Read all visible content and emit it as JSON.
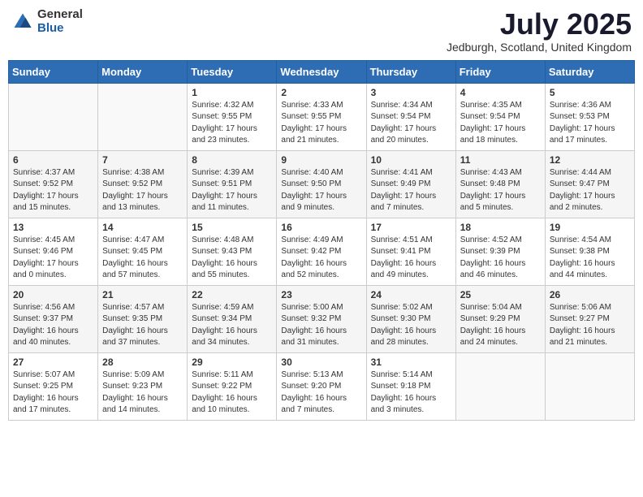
{
  "logo": {
    "general": "General",
    "blue": "Blue"
  },
  "title": "July 2025",
  "location": "Jedburgh, Scotland, United Kingdom",
  "weekdays": [
    "Sunday",
    "Monday",
    "Tuesday",
    "Wednesday",
    "Thursday",
    "Friday",
    "Saturday"
  ],
  "weeks": [
    [
      {
        "day": "",
        "sunrise": "",
        "sunset": "",
        "daylight": ""
      },
      {
        "day": "",
        "sunrise": "",
        "sunset": "",
        "daylight": ""
      },
      {
        "day": "1",
        "sunrise": "Sunrise: 4:32 AM",
        "sunset": "Sunset: 9:55 PM",
        "daylight": "Daylight: 17 hours and 23 minutes."
      },
      {
        "day": "2",
        "sunrise": "Sunrise: 4:33 AM",
        "sunset": "Sunset: 9:55 PM",
        "daylight": "Daylight: 17 hours and 21 minutes."
      },
      {
        "day": "3",
        "sunrise": "Sunrise: 4:34 AM",
        "sunset": "Sunset: 9:54 PM",
        "daylight": "Daylight: 17 hours and 20 minutes."
      },
      {
        "day": "4",
        "sunrise": "Sunrise: 4:35 AM",
        "sunset": "Sunset: 9:54 PM",
        "daylight": "Daylight: 17 hours and 18 minutes."
      },
      {
        "day": "5",
        "sunrise": "Sunrise: 4:36 AM",
        "sunset": "Sunset: 9:53 PM",
        "daylight": "Daylight: 17 hours and 17 minutes."
      }
    ],
    [
      {
        "day": "6",
        "sunrise": "Sunrise: 4:37 AM",
        "sunset": "Sunset: 9:52 PM",
        "daylight": "Daylight: 17 hours and 15 minutes."
      },
      {
        "day": "7",
        "sunrise": "Sunrise: 4:38 AM",
        "sunset": "Sunset: 9:52 PM",
        "daylight": "Daylight: 17 hours and 13 minutes."
      },
      {
        "day": "8",
        "sunrise": "Sunrise: 4:39 AM",
        "sunset": "Sunset: 9:51 PM",
        "daylight": "Daylight: 17 hours and 11 minutes."
      },
      {
        "day": "9",
        "sunrise": "Sunrise: 4:40 AM",
        "sunset": "Sunset: 9:50 PM",
        "daylight": "Daylight: 17 hours and 9 minutes."
      },
      {
        "day": "10",
        "sunrise": "Sunrise: 4:41 AM",
        "sunset": "Sunset: 9:49 PM",
        "daylight": "Daylight: 17 hours and 7 minutes."
      },
      {
        "day": "11",
        "sunrise": "Sunrise: 4:43 AM",
        "sunset": "Sunset: 9:48 PM",
        "daylight": "Daylight: 17 hours and 5 minutes."
      },
      {
        "day": "12",
        "sunrise": "Sunrise: 4:44 AM",
        "sunset": "Sunset: 9:47 PM",
        "daylight": "Daylight: 17 hours and 2 minutes."
      }
    ],
    [
      {
        "day": "13",
        "sunrise": "Sunrise: 4:45 AM",
        "sunset": "Sunset: 9:46 PM",
        "daylight": "Daylight: 17 hours and 0 minutes."
      },
      {
        "day": "14",
        "sunrise": "Sunrise: 4:47 AM",
        "sunset": "Sunset: 9:45 PM",
        "daylight": "Daylight: 16 hours and 57 minutes."
      },
      {
        "day": "15",
        "sunrise": "Sunrise: 4:48 AM",
        "sunset": "Sunset: 9:43 PM",
        "daylight": "Daylight: 16 hours and 55 minutes."
      },
      {
        "day": "16",
        "sunrise": "Sunrise: 4:49 AM",
        "sunset": "Sunset: 9:42 PM",
        "daylight": "Daylight: 16 hours and 52 minutes."
      },
      {
        "day": "17",
        "sunrise": "Sunrise: 4:51 AM",
        "sunset": "Sunset: 9:41 PM",
        "daylight": "Daylight: 16 hours and 49 minutes."
      },
      {
        "day": "18",
        "sunrise": "Sunrise: 4:52 AM",
        "sunset": "Sunset: 9:39 PM",
        "daylight": "Daylight: 16 hours and 46 minutes."
      },
      {
        "day": "19",
        "sunrise": "Sunrise: 4:54 AM",
        "sunset": "Sunset: 9:38 PM",
        "daylight": "Daylight: 16 hours and 44 minutes."
      }
    ],
    [
      {
        "day": "20",
        "sunrise": "Sunrise: 4:56 AM",
        "sunset": "Sunset: 9:37 PM",
        "daylight": "Daylight: 16 hours and 40 minutes."
      },
      {
        "day": "21",
        "sunrise": "Sunrise: 4:57 AM",
        "sunset": "Sunset: 9:35 PM",
        "daylight": "Daylight: 16 hours and 37 minutes."
      },
      {
        "day": "22",
        "sunrise": "Sunrise: 4:59 AM",
        "sunset": "Sunset: 9:34 PM",
        "daylight": "Daylight: 16 hours and 34 minutes."
      },
      {
        "day": "23",
        "sunrise": "Sunrise: 5:00 AM",
        "sunset": "Sunset: 9:32 PM",
        "daylight": "Daylight: 16 hours and 31 minutes."
      },
      {
        "day": "24",
        "sunrise": "Sunrise: 5:02 AM",
        "sunset": "Sunset: 9:30 PM",
        "daylight": "Daylight: 16 hours and 28 minutes."
      },
      {
        "day": "25",
        "sunrise": "Sunrise: 5:04 AM",
        "sunset": "Sunset: 9:29 PM",
        "daylight": "Daylight: 16 hours and 24 minutes."
      },
      {
        "day": "26",
        "sunrise": "Sunrise: 5:06 AM",
        "sunset": "Sunset: 9:27 PM",
        "daylight": "Daylight: 16 hours and 21 minutes."
      }
    ],
    [
      {
        "day": "27",
        "sunrise": "Sunrise: 5:07 AM",
        "sunset": "Sunset: 9:25 PM",
        "daylight": "Daylight: 16 hours and 17 minutes."
      },
      {
        "day": "28",
        "sunrise": "Sunrise: 5:09 AM",
        "sunset": "Sunset: 9:23 PM",
        "daylight": "Daylight: 16 hours and 14 minutes."
      },
      {
        "day": "29",
        "sunrise": "Sunrise: 5:11 AM",
        "sunset": "Sunset: 9:22 PM",
        "daylight": "Daylight: 16 hours and 10 minutes."
      },
      {
        "day": "30",
        "sunrise": "Sunrise: 5:13 AM",
        "sunset": "Sunset: 9:20 PM",
        "daylight": "Daylight: 16 hours and 7 minutes."
      },
      {
        "day": "31",
        "sunrise": "Sunrise: 5:14 AM",
        "sunset": "Sunset: 9:18 PM",
        "daylight": "Daylight: 16 hours and 3 minutes."
      },
      {
        "day": "",
        "sunrise": "",
        "sunset": "",
        "daylight": ""
      },
      {
        "day": "",
        "sunrise": "",
        "sunset": "",
        "daylight": ""
      }
    ]
  ]
}
